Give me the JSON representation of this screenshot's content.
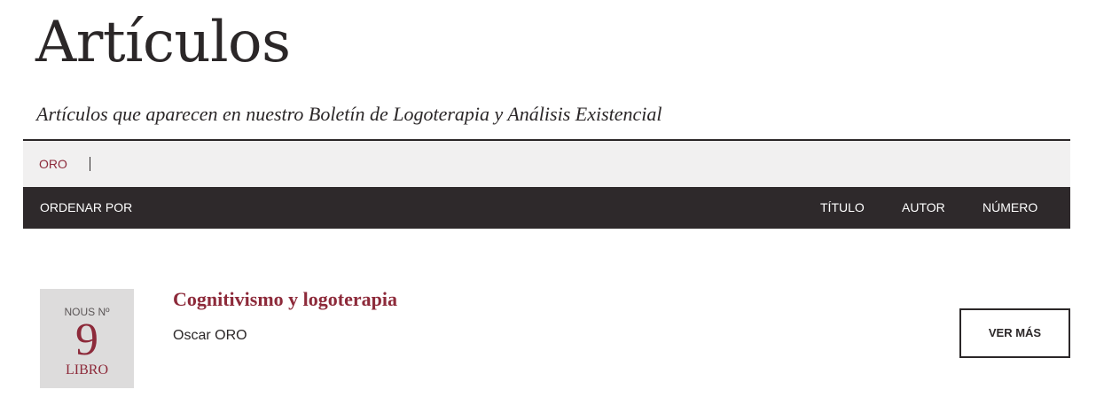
{
  "header": {
    "title": "Artículos",
    "subtitle": "Artículos que aparecen en nuestro Boletín de Logoterapia y Análisis Existencial"
  },
  "search": {
    "value": "ORO"
  },
  "sort": {
    "label": "ORDENAR POR",
    "options": [
      "TÍTULO",
      "AUTOR",
      "NÚMERO"
    ]
  },
  "results": [
    {
      "issue_label": "NOUS Nº",
      "issue_number": "9",
      "issue_type": "LIBRO",
      "title": "Cognitivismo y logoterapia",
      "author": "Oscar ORO",
      "button_label": "VER MÁS"
    }
  ],
  "colors": {
    "accent": "#8d2a3a",
    "dark_bar": "#2e292b",
    "search_bg": "#f1f0f0",
    "issue_bg": "#dddcdc"
  }
}
